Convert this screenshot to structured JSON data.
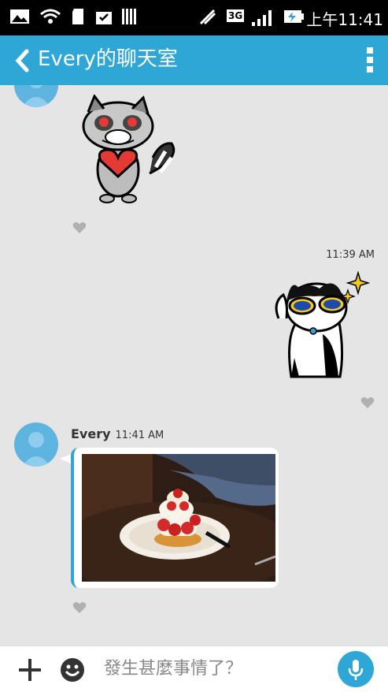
{
  "status_bar": {
    "time": "上午11:41",
    "network": "3G"
  },
  "app_bar": {
    "title": "Every的聊天室",
    "back_icon": "chevron-left-icon",
    "menu_icon": "more-vert-icon"
  },
  "messages": {
    "sent_time": "11:39 AM",
    "sender_name": "Every",
    "received_time": "11:41 AM"
  },
  "input_bar": {
    "placeholder": "發生甚麼事情了？"
  },
  "colors": {
    "accent": "#2ea6d6",
    "background": "#e5e5e5",
    "heart": "#b0b0b0"
  }
}
